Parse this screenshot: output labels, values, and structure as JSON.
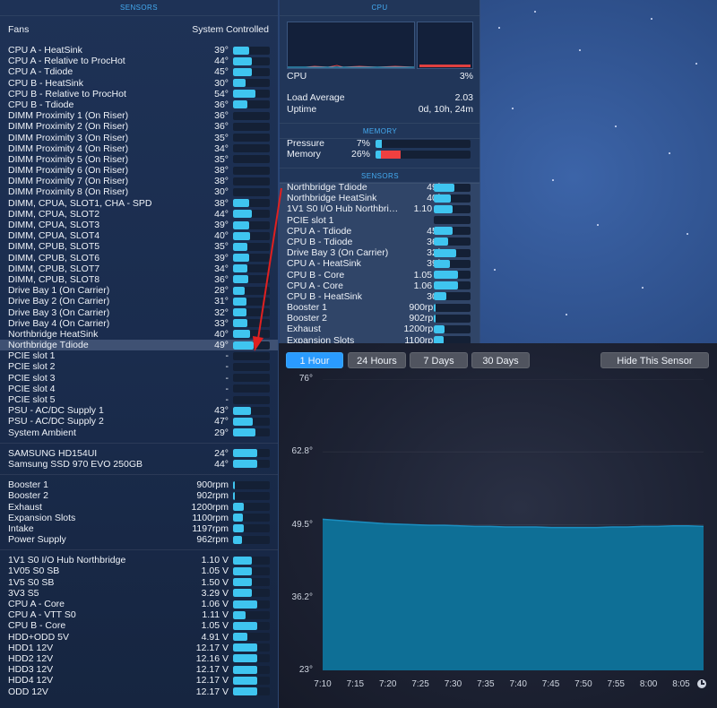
{
  "left_panel": {
    "section_title": "SENSORS",
    "fans_label": "Fans",
    "fans_mode": "System Controlled",
    "temperatures": [
      {
        "name": "CPU A - HeatSink",
        "value": "39°",
        "level": 0.45
      },
      {
        "name": "CPU A - Relative to ProcHot",
        "value": "44°",
        "level": 0.5
      },
      {
        "name": "CPU A - Tdiode",
        "value": "45°",
        "level": 0.5
      },
      {
        "name": "CPU B - HeatSink",
        "value": "30°",
        "level": 0.33
      },
      {
        "name": "CPU B - Relative to ProcHot",
        "value": "54°",
        "level": 0.62
      },
      {
        "name": "CPU B - Tdiode",
        "value": "36°",
        "level": 0.4
      },
      {
        "name": "DIMM Proximity 1 (On Riser)",
        "value": "36°",
        "level": 0
      },
      {
        "name": "DIMM Proximity 2 (On Riser)",
        "value": "36°",
        "level": 0
      },
      {
        "name": "DIMM Proximity 3 (On Riser)",
        "value": "35°",
        "level": 0
      },
      {
        "name": "DIMM Proximity 4 (On Riser)",
        "value": "34°",
        "level": 0
      },
      {
        "name": "DIMM Proximity 5 (On Riser)",
        "value": "35°",
        "level": 0
      },
      {
        "name": "DIMM Proximity 6 (On Riser)",
        "value": "38°",
        "level": 0
      },
      {
        "name": "DIMM Proximity 7 (On Riser)",
        "value": "38°",
        "level": 0
      },
      {
        "name": "DIMM Proximity 8 (On Riser)",
        "value": "30°",
        "level": 0
      },
      {
        "name": "DIMM, CPUA, SLOT1, CHA - SPD",
        "value": "38°",
        "level": 0.43
      },
      {
        "name": "DIMM, CPUA, SLOT2",
        "value": "44°",
        "level": 0.5
      },
      {
        "name": "DIMM, CPUA, SLOT3",
        "value": "39°",
        "level": 0.45
      },
      {
        "name": "DIMM, CPUA, SLOT4",
        "value": "40°",
        "level": 0.46
      },
      {
        "name": "DIMM, CPUB, SLOT5",
        "value": "35°",
        "level": 0.4
      },
      {
        "name": "DIMM, CPUB, SLOT6",
        "value": "39°",
        "level": 0.45
      },
      {
        "name": "DIMM, CPUB, SLOT7",
        "value": "34°",
        "level": 0.39
      },
      {
        "name": "DIMM, CPUB, SLOT8",
        "value": "36°",
        "level": 0.41
      },
      {
        "name": "Drive Bay 1 (On Carrier)",
        "value": "28°",
        "level": 0.32
      },
      {
        "name": "Drive Bay 2 (On Carrier)",
        "value": "31°",
        "level": 0.36
      },
      {
        "name": "Drive Bay 3 (On Carrier)",
        "value": "32°",
        "level": 0.37
      },
      {
        "name": "Drive Bay 4 (On Carrier)",
        "value": "33°",
        "level": 0.38
      },
      {
        "name": "Northbridge HeatSink",
        "value": "40°",
        "level": 0.46
      },
      {
        "name": "Northbridge Tdiode",
        "value": "49°",
        "level": 0.56
      },
      {
        "name": "PCIE slot 1",
        "value": "-",
        "level": 0
      },
      {
        "name": "PCIE slot 2",
        "value": "-",
        "level": 0
      },
      {
        "name": "PCIE slot 3",
        "value": "-",
        "level": 0
      },
      {
        "name": "PCIE slot 4",
        "value": "-",
        "level": 0
      },
      {
        "name": "PCIE slot 5",
        "value": "-",
        "level": 0
      },
      {
        "name": "PSU - AC/DC Supply 1",
        "value": "43°",
        "level": 0.49
      },
      {
        "name": "PSU - AC/DC Supply 2",
        "value": "47°",
        "level": 0.54
      },
      {
        "name": "System Ambient",
        "value": "29°",
        "level": 0.62
      }
    ],
    "drives": [
      {
        "name": "SAMSUNG HD154UI",
        "value": "24°",
        "level": 0.65
      },
      {
        "name": "Samsung SSD 970 EVO 250GB",
        "value": "44°",
        "level": 0.65
      }
    ],
    "fans": [
      {
        "name": "Booster 1",
        "value": "900rpm",
        "level": 0.06
      },
      {
        "name": "Booster 2",
        "value": "902rpm",
        "level": 0.06
      },
      {
        "name": "Exhaust",
        "value": "1200rpm",
        "level": 0.3
      },
      {
        "name": "Expansion Slots",
        "value": "1100rpm",
        "level": 0.28
      },
      {
        "name": "Intake",
        "value": "1197rpm",
        "level": 0.3
      },
      {
        "name": "Power Supply",
        "value": "962rpm",
        "level": 0.24
      }
    ],
    "voltages": [
      {
        "name": "1V1 S0 I/O Hub Northbridge",
        "value": "1.10 V",
        "level": 0.5
      },
      {
        "name": "1V05 S0 SB",
        "value": "1.05 V",
        "level": 0.5
      },
      {
        "name": "1V5 S0 SB",
        "value": "1.50 V",
        "level": 0.5
      },
      {
        "name": "3V3 S5",
        "value": "3.29 V",
        "level": 0.5
      },
      {
        "name": "CPU A - Core",
        "value": "1.06 V",
        "level": 0.65
      },
      {
        "name": "CPU A - VTT S0",
        "value": "1.11 V",
        "level": 0.35
      },
      {
        "name": "CPU B - Core",
        "value": "1.05 V",
        "level": 0.65
      },
      {
        "name": "HDD+ODD 5V",
        "value": "4.91 V",
        "level": 0.4
      },
      {
        "name": "HDD1 12V",
        "value": "12.17 V",
        "level": 0.65
      },
      {
        "name": "HDD2 12V",
        "value": "12.16 V",
        "level": 0.65
      },
      {
        "name": "HDD3 12V",
        "value": "12.17 V",
        "level": 0.65
      },
      {
        "name": "HDD4 12V",
        "value": "12.17 V",
        "level": 0.65
      },
      {
        "name": "ODD 12V",
        "value": "12.17 V",
        "level": 0.65
      }
    ]
  },
  "cpu": {
    "title": "CPU",
    "label": "CPU",
    "value": "3%",
    "load_label": "Load Average",
    "load_value": "2.03",
    "uptime_label": "Uptime",
    "uptime_value": "0d, 10h, 24m"
  },
  "memory": {
    "title": "MEMORY",
    "pressure_label": "Pressure",
    "pressure_value": "7%",
    "pressure_level": 0.07,
    "memory_label": "Memory",
    "memory_value": "26%",
    "memory_level": 0.26
  },
  "mid_sensors": {
    "title": "SENSORS",
    "items": [
      {
        "name": "Northbridge Tdiode",
        "value": "49°",
        "level": 0.56
      },
      {
        "name": "Northbridge HeatSink",
        "value": "40°",
        "level": 0.46
      },
      {
        "name": "1V1 S0 I/O Hub Northbri…",
        "value": "1.10 V",
        "level": 0.5
      },
      {
        "name": "PCIE slot 1",
        "value": "-",
        "level": 0
      },
      {
        "name": "CPU A - Tdiode",
        "value": "45°",
        "level": 0.5
      },
      {
        "name": "CPU B - Tdiode",
        "value": "36°",
        "level": 0.4
      },
      {
        "name": "Drive Bay 3 (On Carrier)",
        "value": "32°",
        "level": 0.62
      },
      {
        "name": "CPU A - HeatSink",
        "value": "39°",
        "level": 0.45
      },
      {
        "name": "CPU B - Core",
        "value": "1.05 V",
        "level": 0.65
      },
      {
        "name": "CPU A - Core",
        "value": "1.06 V",
        "level": 0.65
      },
      {
        "name": "CPU B - HeatSink",
        "value": "30°",
        "level": 0.33
      },
      {
        "name": "Booster 1",
        "value": "900rpm",
        "level": 0.06
      },
      {
        "name": "Booster 2",
        "value": "902rpm",
        "level": 0.06
      },
      {
        "name": "Exhaust",
        "value": "1200rpm",
        "level": 0.3
      },
      {
        "name": "Expansion Slots",
        "value": "1100rpm",
        "level": 0.28
      }
    ]
  },
  "history": {
    "ranges": [
      "1 Hour",
      "24 Hours",
      "7 Days",
      "30 Days"
    ],
    "active_range": "1 Hour",
    "hide_label": "Hide This Sensor"
  },
  "chart_data": {
    "type": "area",
    "title": "",
    "xlabel": "",
    "ylabel": "",
    "ylim": [
      23,
      76
    ],
    "yticks": [
      "76°",
      "62.8°",
      "49.5°",
      "36.2°",
      "23°"
    ],
    "xticks": [
      "7:10",
      "7:15",
      "7:20",
      "7:25",
      "7:30",
      "7:35",
      "7:40",
      "7:45",
      "7:50",
      "7:55",
      "8:00",
      "8:05"
    ],
    "series": [
      {
        "values": [
          50.5,
          50.3,
          50.1,
          49.9,
          49.7,
          49.6,
          49.5,
          49.4,
          49.4,
          49.3,
          49.2,
          49.2,
          49.1,
          49.1,
          49.1,
          49.0,
          49.0,
          49.0,
          49.0,
          49.1,
          49.1,
          49.2,
          49.2,
          49.3,
          49.3,
          49.2
        ]
      }
    ],
    "fill_color": "#0e6f96",
    "line_color": "#1b8ec0",
    "grid": true
  }
}
